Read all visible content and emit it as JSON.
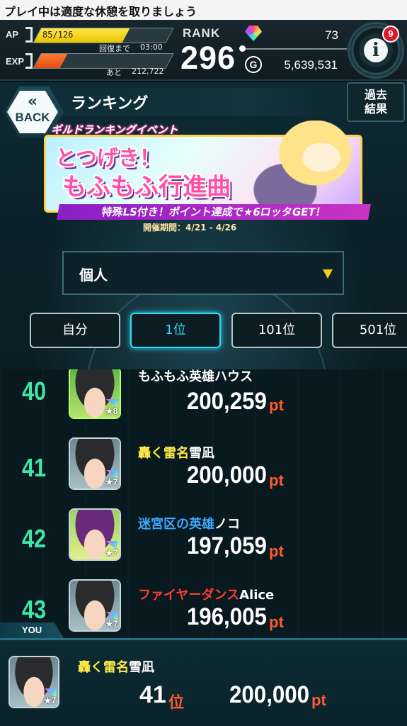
{
  "status_bar": {
    "text": "プレイ中は適度な休憩を取りましょう"
  },
  "hud": {
    "ap_label": "AP",
    "ap_value": "85/126",
    "ap_fill": 0.67,
    "ap_recovery_label": "回復まで",
    "ap_recovery_time": "03:00",
    "exp_label": "EXP",
    "exp_fill": 0.2,
    "exp_remaining_label": "あと",
    "exp_remaining_value": "212,722",
    "rank_label": "RANK",
    "rank_value": "296",
    "gem_count": "73",
    "coin_symbol": "G",
    "coin_count": "5,639,531",
    "info_symbol": "i",
    "notification_count": "9"
  },
  "header": {
    "back_chevron": "«",
    "back_label": "BACK",
    "title": "ランキング",
    "past_results_label_1": "過去",
    "past_results_label_2": "結果"
  },
  "banner": {
    "heading": "ギルドランキングイベント",
    "title_line1": "とつげき！",
    "title_line2": "もふもふ行進曲",
    "tagline": "特殊LS付き！ポイント達成で★6ロッタGET！",
    "period": "開催期間：4/21 - 4/26"
  },
  "dropdown": {
    "selected": "個人"
  },
  "tabs": [
    {
      "label": "自分"
    },
    {
      "label": "1位"
    },
    {
      "label": "101位"
    },
    {
      "label": "501位"
    }
  ],
  "ranking": {
    "unit": "pt",
    "rows": [
      {
        "rank": "40",
        "title": "もふもふ英雄",
        "name": "ハウス",
        "points": "200,259",
        "stars": "★8"
      },
      {
        "rank": "41",
        "title": "轟く雷名",
        "name": "雪凪",
        "points": "200,000",
        "stars": "★7"
      },
      {
        "rank": "42",
        "title": "迷宮区の英雄",
        "name": "ノコ",
        "points": "197,059",
        "stars": "★7"
      },
      {
        "rank": "43",
        "title": "ファイヤーダンス",
        "name": "Alice",
        "points": "196,005",
        "stars": "★7"
      }
    ]
  },
  "you": {
    "tag": "YOU",
    "title": "轟く雷名",
    "name": "雪凪",
    "rank": "41",
    "rank_unit": "位",
    "points": "200,000",
    "points_unit": "pt",
    "stars": "★7"
  },
  "colors": {
    "rank_number": "#3ee6a8",
    "points_unit": "#ff5b2a",
    "active_tab": "#2fd9f2",
    "title_yellow": "#ffe94a",
    "title_blue": "#3fa8ff",
    "title_red": "#ff3b2f"
  }
}
